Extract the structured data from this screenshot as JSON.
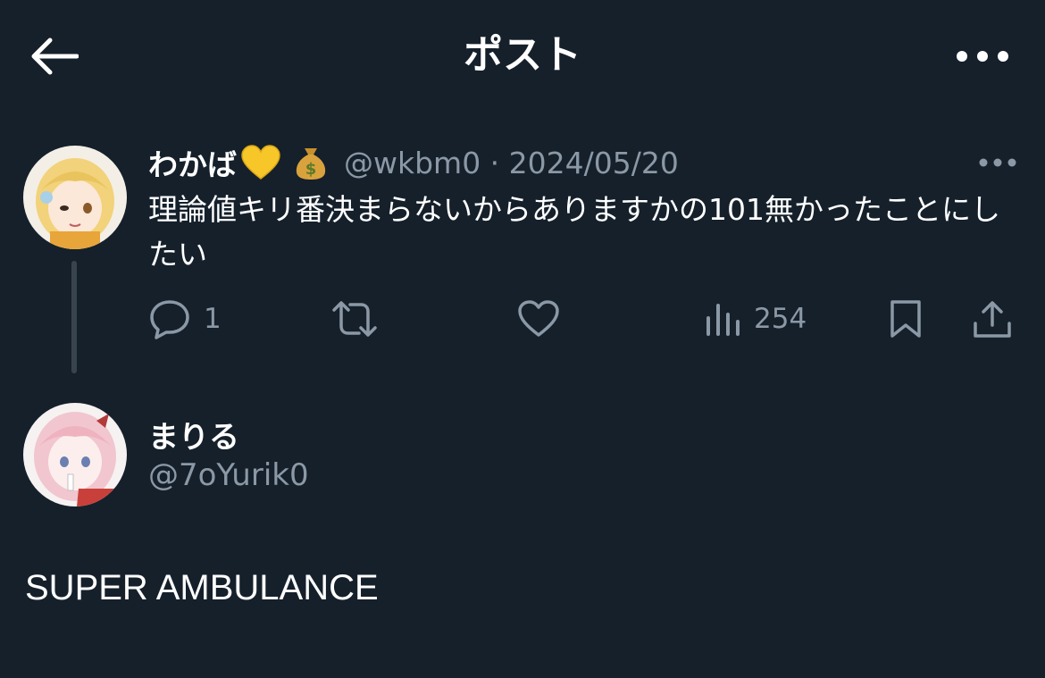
{
  "header": {
    "title": "ポスト",
    "back_icon": "arrow-left-icon",
    "more_icon": "more-horizontal-icon"
  },
  "parent_tweet": {
    "display_name": "わかば",
    "name_emojis": [
      "yellow-heart-icon",
      "money-bag-icon"
    ],
    "handle_meta": "@wkbm0 · 2024/05/20",
    "text": "理論値キリ番決まらないからありますかの101無かったことにしたい",
    "reply_count": "1",
    "retweet_count": "",
    "like_count": "",
    "view_count": "254"
  },
  "reply": {
    "display_name": "まりる",
    "handle": "@7oYurik0",
    "text": "SUPER AMBULANCE"
  },
  "colors": {
    "background": "#15202b",
    "secondary_text": "#8b98a5",
    "thread_line": "#38444d"
  }
}
